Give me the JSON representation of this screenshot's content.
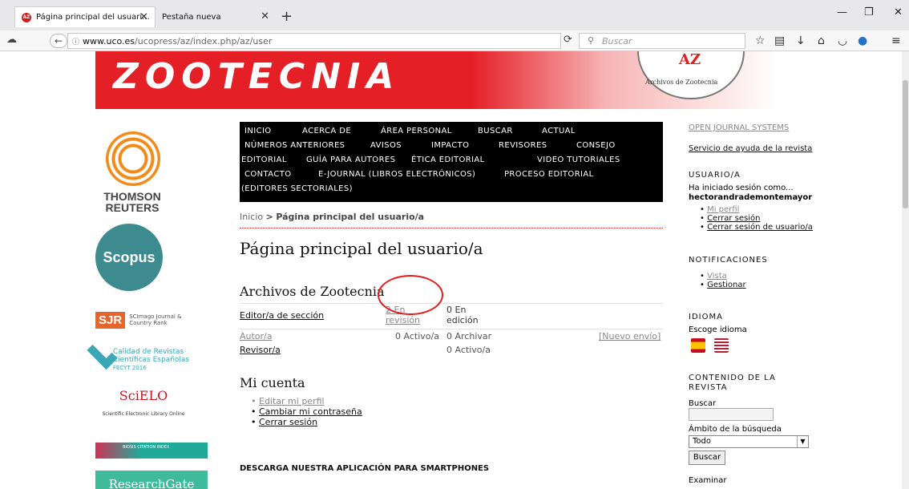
{
  "browser": {
    "tabs": [
      {
        "label": "Página principal del usuari..."
      },
      {
        "label": "Pestaña nueva"
      }
    ],
    "url_domain": "www.uco.es",
    "url_path": "/ucopress/az/index.php/az/user",
    "search_placeholder": "Buscar"
  },
  "banner": {
    "title": "ZOOTECNIA",
    "seal_text_1": "AZ",
    "seal_text_2": "Archivos de Zootecnia"
  },
  "left_logos": {
    "thomson": "THOMSON REUTERS",
    "scopus": "Scopus",
    "sjr": "SJR",
    "sjr_sub": "SCImago Journal & Country Rank",
    "calidad": "Calidad de Revistas Científicas Españolas",
    "fecyt": "FECYT 2016",
    "scielo": "SciELO",
    "scielo_sub": "Scientific Electronic Library Online",
    "biosis": "BIOSIS CITATION INDEX",
    "researchgate": "ResearchGate"
  },
  "menu": {
    "row1": [
      "INICIO",
      "ACERCA DE",
      "ÁREA PERSONAL",
      "BUSCAR",
      "ACTUAL"
    ],
    "row2": [
      "NÚMEROS ANTERIORES",
      "AVISOS",
      "IMPACTO",
      "REVISORES",
      "CONSEJO"
    ],
    "row3": [
      "EDITORIAL",
      "GUÍA PARA AUTORES",
      "ÉTICA EDITORIAL",
      "VIDEO TUTORIALES"
    ],
    "row4": [
      "CONTACTO",
      "E-JOURNAL (LIBROS ELECTRÓNICOS)",
      "PROCESO EDITORIAL"
    ],
    "row5": [
      "(EDITORES SECTORIALES)"
    ]
  },
  "breadcrumb": {
    "home": "Inicio",
    "sep": ">",
    "current": "Página principal del usuario/a"
  },
  "main": {
    "title": "Página principal del usuario/a",
    "journal": "Archivos de Zootecnia",
    "roles": {
      "editor": {
        "name": "Editor/a de sección",
        "a": "2 En",
        "a2": "revisión",
        "b": "0 En",
        "b2": "edición"
      },
      "author": {
        "name": "Autor/a",
        "a": "0 Activo/a",
        "b": "0 Archivar",
        "c": "[Nuevo envío]"
      },
      "reviewer": {
        "name": "Revisor/a",
        "b": "0 Activo/a"
      }
    },
    "account_title": "Mi cuenta",
    "account_links": [
      "Editar mi perfil",
      "Cambiar mi contraseña",
      "Cerrar sesión"
    ],
    "download": "DESCARGA NUESTRA APLICACIÓN PARA SMARTPHONES"
  },
  "right": {
    "ojs": "OPEN JOURNAL SYSTEMS",
    "help": "Servicio de ayuda de la revista",
    "user_head": "USUARIO/A",
    "logged": "Ha iniciado sesión como...",
    "username": "hectorandrademontemayor",
    "user_links": [
      "Mi perfil",
      "Cerrar sesión",
      "Cerrar sesión de usuario/a"
    ],
    "notif_head": "NOTIFICACIONES",
    "notif_links": [
      "Vista",
      "Gestionar"
    ],
    "lang_head": "IDIOMA",
    "lang_label": "Escoge idioma",
    "content_head_1": "CONTENIDO DE LA",
    "content_head_2": "REVISTA",
    "search_label": "Buscar",
    "scope_label": "Ámbito de la búsqueda",
    "scope_value": "Todo",
    "search_btn": "Buscar",
    "browse": "Examinar"
  }
}
